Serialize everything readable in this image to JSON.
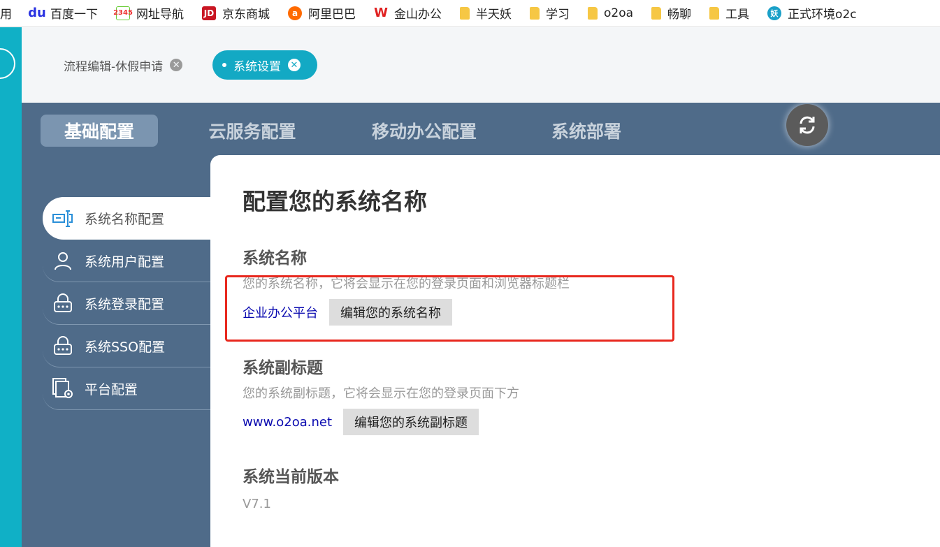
{
  "bookmarks": [
    {
      "label": "用",
      "icon": "none"
    },
    {
      "label": "百度一下",
      "icon": "baidu-icon"
    },
    {
      "label": "网址导航",
      "icon": "2345-icon"
    },
    {
      "label": "京东商城",
      "icon": "jd-icon"
    },
    {
      "label": "阿里巴巴",
      "icon": "alibaba-icon"
    },
    {
      "label": "金山办公",
      "icon": "wps-icon"
    },
    {
      "label": "半天妖",
      "icon": "folder-icon"
    },
    {
      "label": "学习",
      "icon": "folder-icon"
    },
    {
      "label": "o2oa",
      "icon": "folder-icon"
    },
    {
      "label": "畅聊",
      "icon": "folder-icon"
    },
    {
      "label": "工具",
      "icon": "folder-icon"
    },
    {
      "label": "正式环境o2c",
      "icon": "yao-icon"
    }
  ],
  "bookmark_icon_text": {
    "baidu": "du",
    "s2345": "2345",
    "jd": "JD",
    "ali": "a",
    "wps": "W",
    "yao": "妖"
  },
  "tabs": [
    {
      "label": "流程编辑-休假申请",
      "active": false
    },
    {
      "label": "系统设置",
      "active": true
    }
  ],
  "top_nav": [
    "基础配置",
    "云服务配置",
    "移动办公配置",
    "系统部署"
  ],
  "side_menu": [
    {
      "label": "系统名称配置",
      "icon": "name-config-icon"
    },
    {
      "label": "系统用户配置",
      "icon": "user-icon"
    },
    {
      "label": "系统登录配置",
      "icon": "lock-icon"
    },
    {
      "label": "系统SSO配置",
      "icon": "lock-icon"
    },
    {
      "label": "平台配置",
      "icon": "platform-settings-icon"
    }
  ],
  "content": {
    "title": "配置您的系统名称",
    "system_name": {
      "heading": "系统名称",
      "description": "您的系统名称，它将会显示在您的登录页面和浏览器标题栏",
      "value": "企业办公平台",
      "button": "编辑您的系统名称"
    },
    "subtitle": {
      "heading": "系统副标题",
      "description": "您的系统副标题，它将会显示在您的登录页面下方",
      "value": "www.o2oa.net",
      "button": "编辑您的系统副标题"
    },
    "version": {
      "heading": "系统当前版本",
      "value": "V7.1"
    }
  },
  "colors": {
    "teal": "#10b0c6",
    "panel": "#4f6b89",
    "highlight": "#e8281e"
  }
}
